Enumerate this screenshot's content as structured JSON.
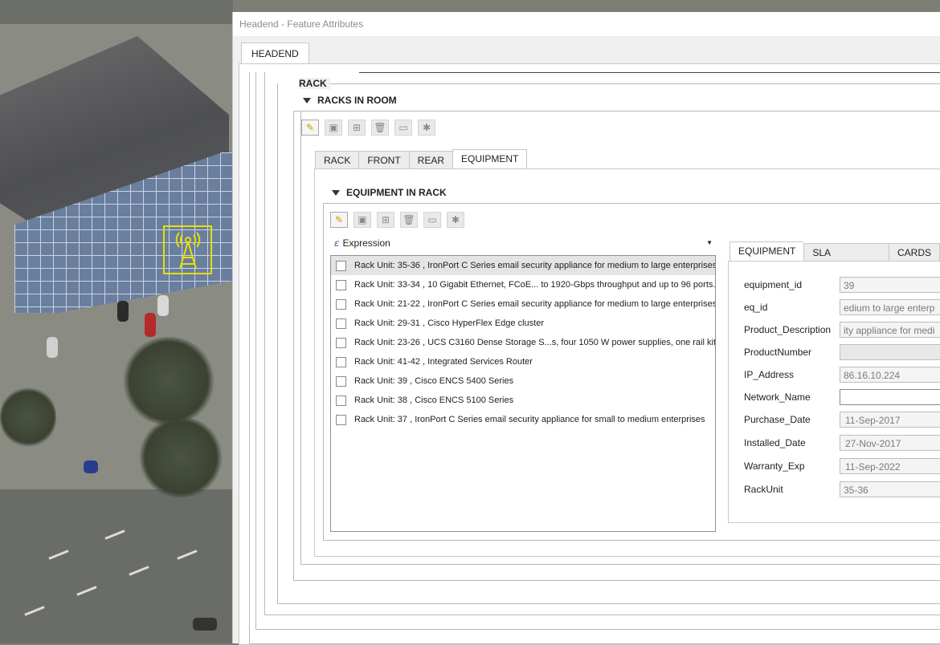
{
  "window": {
    "title": "Headend - Feature Attributes"
  },
  "main_tab": {
    "label": "HEADEND"
  },
  "rack_group": {
    "title": "RACK"
  },
  "racks_in_room": {
    "title": "RACKS IN ROOM"
  },
  "rack_tabs": [
    {
      "label": "RACK"
    },
    {
      "label": "FRONT"
    },
    {
      "label": "REAR"
    },
    {
      "label": "EQUIPMENT",
      "active": true
    }
  ],
  "equipment_in_rack": {
    "title": "EQUIPMENT IN RACK"
  },
  "expression": {
    "label": "Expression"
  },
  "equipment_list": [
    {
      "text": "Rack Unit: 35-36 , IronPort C Series email security appliance for medium to large enterprises",
      "selected": true
    },
    {
      "text": "Rack Unit: 33-34 , 10 Gigabit Ethernet, FCoE... to 1920-Gbps throughput and up to 96 ports."
    },
    {
      "text": "Rack Unit: 21-22 , IronPort C Series email security appliance for medium to large enterprises"
    },
    {
      "text": "Rack Unit: 29-31 , Cisco HyperFlex Edge cluster"
    },
    {
      "text": "Rack Unit: 23-26 , UCS C3160 Dense Storage S...s, four 1050 W power supplies, one rail kit."
    },
    {
      "text": "Rack Unit: 41-42 , Integrated Services Router"
    },
    {
      "text": "Rack Unit: 39 , Cisco ENCS 5400 Series"
    },
    {
      "text": "Rack Unit: 38 , Cisco ENCS 5100 Series"
    },
    {
      "text": "Rack Unit: 37 , IronPort C Series email security appliance for small to medium enterprises"
    }
  ],
  "detail_tabs": [
    {
      "label": "EQUIPMENT",
      "active": true
    },
    {
      "label": "SLA CONTRACT"
    },
    {
      "label": "CARDS"
    }
  ],
  "fields": [
    {
      "label": "equipment_id",
      "value": "39"
    },
    {
      "label": "eq_id",
      "value": "edium to large enterp"
    },
    {
      "label": "Product_Description",
      "value": "ity appliance for medi"
    },
    {
      "label": "ProductNumber",
      "value": ""
    },
    {
      "label": "IP_Address",
      "value": "86.16.10.224"
    },
    {
      "label": "Network_Name",
      "value": ""
    },
    {
      "label": "Purchase_Date",
      "value": "11-Sep-2017"
    },
    {
      "label": "Installed_Date",
      "value": "27-Nov-2017"
    },
    {
      "label": "Warranty_Exp",
      "value": "11-Sep-2022"
    },
    {
      "label": "RackUnit",
      "value": "35-36"
    }
  ],
  "toolbar_icons": [
    "edit-pencil-icon",
    "save-icon",
    "add-feature-icon",
    "delete-icon",
    "link-icon",
    "zoom-to-icon"
  ]
}
